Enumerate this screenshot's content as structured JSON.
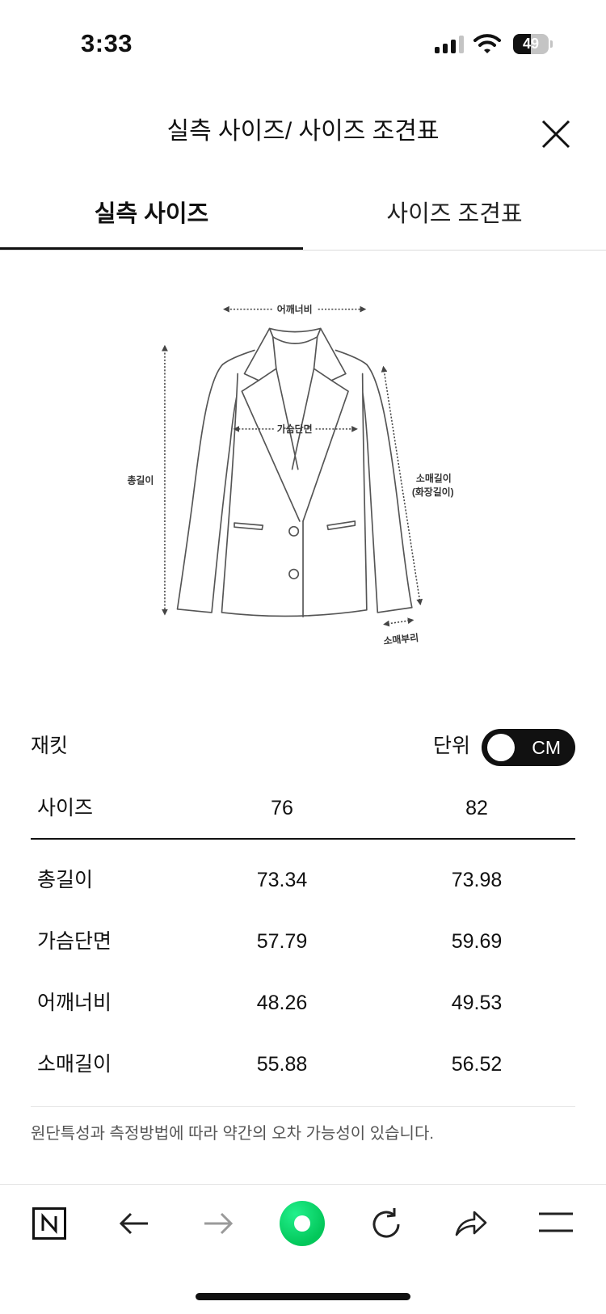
{
  "status_bar": {
    "time": "3:33",
    "battery": "49",
    "battery_level": 0.49
  },
  "header": {
    "title": "실측 사이즈/ 사이즈 조견표",
    "close_icon": "close-icon"
  },
  "tabs": [
    {
      "label": "실측 사이즈",
      "active": true
    },
    {
      "label": "사이즈 조견표",
      "active": false
    }
  ],
  "diagram": {
    "labels": {
      "shoulder": "어깨너비",
      "chest": "가슴단면",
      "total_length": "총길이",
      "sleeve_length": "소매길이",
      "sleeve_length_alt": "(화장길이)",
      "cuff": "소매부리"
    }
  },
  "size_table": {
    "category": "재킷",
    "unit_label": "단위",
    "unit_value": "CM",
    "headers": [
      "사이즈",
      "76",
      "82"
    ],
    "rows": [
      {
        "label": "총길이",
        "values": [
          "73.34",
          "73.98"
        ]
      },
      {
        "label": "가슴단면",
        "values": [
          "57.79",
          "59.69"
        ]
      },
      {
        "label": "어깨너비",
        "values": [
          "48.26",
          "49.53"
        ]
      },
      {
        "label": "소매길이",
        "values": [
          "55.88",
          "56.52"
        ]
      }
    ]
  },
  "note": "원단특성과 측정방법에 따라 약간의 오차 가능성이 있습니다.",
  "bottom_bar": {
    "icons": [
      "naver-n-icon",
      "back-arrow-icon",
      "forward-arrow-icon",
      "green-dot-icon",
      "reload-icon",
      "share-icon",
      "menu-icon"
    ]
  },
  "colors": {
    "brand_green": "#03c75a",
    "text": "#111111",
    "disabled_icon": "#9a9a9a"
  }
}
